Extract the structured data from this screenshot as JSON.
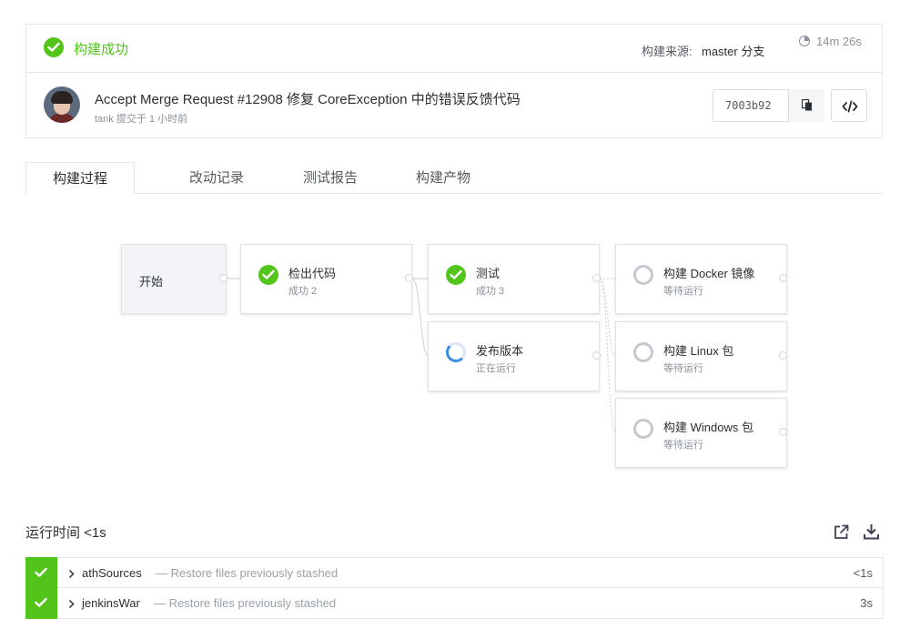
{
  "status": {
    "text": "构建成功",
    "source_label": "构建来源:",
    "source_branch": "master 分支",
    "duration": "14m 26s",
    "color": "#52c41a"
  },
  "commit": {
    "title": "Accept Merge Request #12908 修复 CoreException 中的错误反馈代码",
    "author": "tank",
    "submitted": "提交于 1 小时前",
    "hash": "7003b92"
  },
  "tabs": [
    {
      "label": "构建过程"
    },
    {
      "label": "改动记录"
    },
    {
      "label": "测试报告"
    },
    {
      "label": "构建产物"
    }
  ],
  "pipeline": {
    "start": {
      "name": "开始"
    },
    "stages": [
      {
        "name": "检出代码",
        "status": "成功 2",
        "state": "success"
      },
      {
        "name": "测试",
        "status": "成功 3",
        "state": "success"
      },
      {
        "name": "发布版本",
        "status": "正在运行",
        "state": "running"
      },
      {
        "name": "构建 Docker 镜像",
        "status": "等待运行",
        "state": "waiting"
      },
      {
        "name": "构建 Linux 包",
        "status": "等待运行",
        "state": "waiting"
      },
      {
        "name": "构建 Windows 包",
        "status": "等待运行",
        "state": "waiting"
      }
    ]
  },
  "runtime": {
    "title": "运行时间 <1s",
    "steps": [
      {
        "name": "athSources",
        "desc": "— Restore files previously stashed",
        "time": "<1s"
      },
      {
        "name": "jenkinsWar",
        "desc": "— Restore files previously stashed",
        "time": "3s"
      }
    ]
  },
  "icons": {
    "status": "check-circle-icon",
    "duration": "clock-icon",
    "copy": "copy-icon",
    "code": "code-icon",
    "external": "external-link-icon",
    "download": "download-icon",
    "expand": "chevron-right-icon"
  },
  "colors": {
    "success": "#52c41a",
    "running": "#3b8ce3",
    "waiting": "#c5c9cf"
  }
}
